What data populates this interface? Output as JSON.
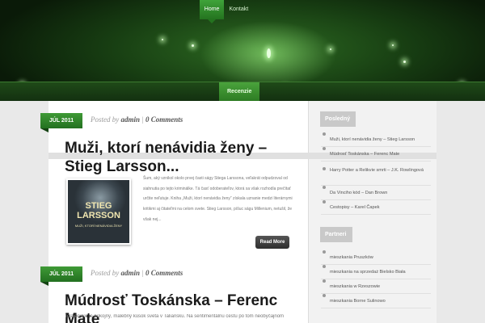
{
  "nav": {
    "items": [
      {
        "label": "Home",
        "active": true
      },
      {
        "label": "Kontakt",
        "active": false
      }
    ]
  },
  "category_bar": {
    "label": "Recenzie"
  },
  "posts": [
    {
      "date": "JÚL 2011",
      "meta_prefix": "Posted by",
      "author": "admin",
      "meta_sep": "|",
      "comments": "0 Comments",
      "title": "Muži, ktorí nenávidia ženy – Stieg Larsson...",
      "thumb": {
        "line1": "STIEG",
        "line2": "LARSSON",
        "line3": "MUŽI, KTORÍ NENÁVIDIA ŽENY"
      },
      "excerpt": "Šum, aký vznikol okolo prvej časti ságy Stiega Larssona, veľakrát odpudzoval od siahnutia po tejto kriminálke. Tá časť odoberateľov, ktorá sa však rozhodla prečítať určite neľutuje. Kniha „Muži, ktorí nenávidia ženy“ získala uznanie medzi literárnymi kritikmi aj čitateľmi na celom svete. Stieg Larsson, píšuc ságu Millenium, netušil, že však nej...",
      "more": "Read More"
    },
    {
      "date": "JÚL 2011",
      "meta_prefix": "Posted by",
      "author": "admin",
      "meta_sep": "|",
      "comments": "0 Comments",
      "title": "Múdrosť Toskánska – Ferenc Mate",
      "excerpt": "Toskánsko je pokojný, malebný kúsok sveta v Taliansku. Na sentimentálnu cestu po tom neobyčajnom"
    }
  ],
  "sidebar": {
    "recent": {
      "heading": "Posledný",
      "items": [
        "Muži, ktorí nenávidia ženy – Stieg Larsson",
        "Múdrosť Toskánska – Ferenc Mate",
        "Harry Potter a Relikvie smrti – J.K. Rowlingová",
        "Da Vinciho kód – Dan Brown",
        "Cestopisy – Karel Čapek"
      ]
    },
    "partners": {
      "heading": "Partneri",
      "items": [
        "mieszkania Pruszków",
        "mieszkania na sprzedaż Bielsko Biała",
        "mieszkania w Rzeszowie",
        "mieszkania Borne Sulinowo"
      ]
    }
  },
  "colors": {
    "accent": "#2f8a28",
    "dark_bg": "#0c1a0c",
    "page_bg": "#e9e9e9"
  }
}
